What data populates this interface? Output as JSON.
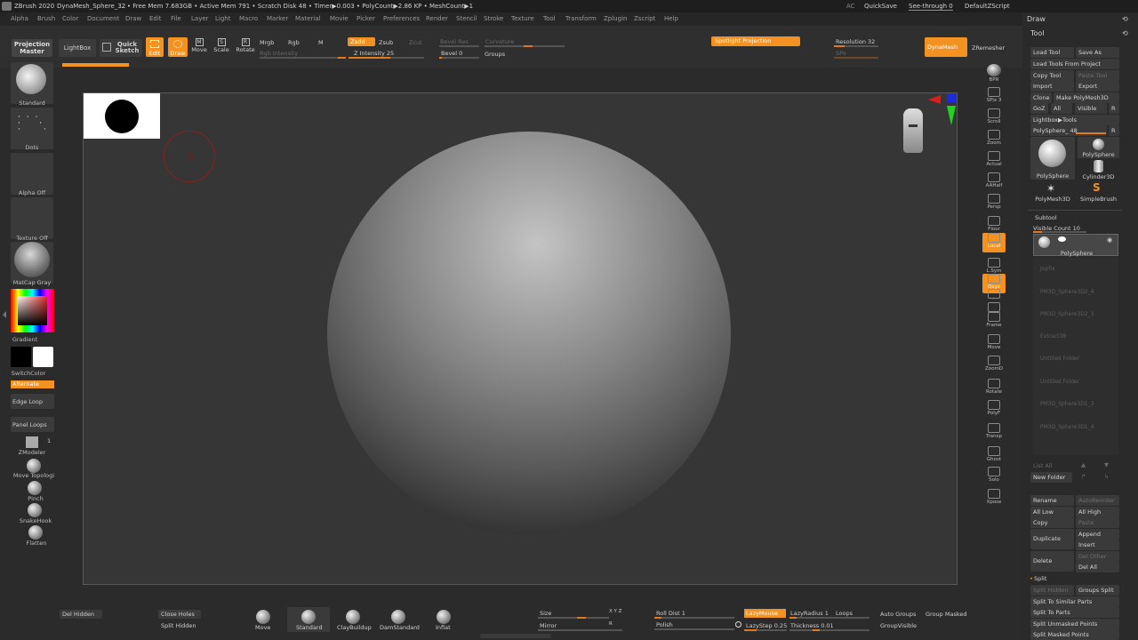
{
  "titlebar": {
    "app": "ZBrush 2020",
    "doc": "DynaMesh_Sphere_32",
    "stats": "... • Free Mem 7.683GB • Active Mem 791 • Scratch Disk 48 • Timer▶0.003 • PolyCount▶2.86 KP • MeshCount▶1",
    "ac": "AC",
    "quicksave": "QuickSave",
    "seethrough": "See-through  0",
    "script": "DefaultZScript"
  },
  "menu": [
    "Alpha",
    "Brush",
    "Color",
    "Document",
    "Draw",
    "Edit",
    "File",
    "Layer",
    "Light",
    "Macro",
    "Marker",
    "Material",
    "Movie",
    "Picker",
    "Preferences",
    "Render",
    "Stencil",
    "Stroke",
    "Texture",
    "Tool",
    "Transform",
    "Zplugin",
    "Zscript",
    "Help"
  ],
  "toolbar": {
    "projection_master": "Projection Master",
    "lightbox": "LightBox",
    "quick_sketch": "Quick Sketch",
    "edit": "Edit",
    "draw": "Draw",
    "move": "Move",
    "scale": "Scale",
    "rotate": "Rotate",
    "mrgb": "Mrgb",
    "rgb": "Rgb",
    "m": "M",
    "rgb_intensity": "Rgb Intensity",
    "zadd": "Zadd",
    "zsub": "Zsub",
    "zcut": "Zcut",
    "z_intensity": "Z Intensity 25",
    "bevel_res": "Bevel Res",
    "bevel": "Bevel 0",
    "curvature": "Curvature",
    "groups": "Groups",
    "spotlight": "Spotlight Projection",
    "resolution": "Resolution 32",
    "polish": "SPo",
    "dynamesh": "DynaMesh",
    "zremesher": "ZRemesher"
  },
  "left": {
    "standard": "Standard",
    "dots": "Dots",
    "alpha_off": "Alpha Off",
    "texture_off": "Texture Off",
    "matcap": "MatCap Gray",
    "gradient": "Gradient",
    "switchcolor": "SwitchColor",
    "alternate": "Alternate",
    "edge_loop": "Edge Loop",
    "panel_loops": "Panel Loops",
    "zmodeler": "ZModeler",
    "zmodeler_num": "1",
    "move_topo": "Move Topologi",
    "pinch": "Pinch",
    "snakehook": "SnakeHook",
    "flatten": "Flatten"
  },
  "rightshelf": [
    "BPR",
    "SPix 3",
    "Scroll",
    "Zoom",
    "Actual",
    "AAHalf",
    "Persp",
    "Floor",
    "Local",
    "L.Sym",
    "Qxyz",
    "",
    "",
    "Frame",
    "Move",
    "ZoomD",
    "Rotate",
    "PolyF",
    "Transp",
    "Ghost",
    "Solo",
    "Xpose"
  ],
  "panel": {
    "draw": "Draw",
    "tool": "Tool",
    "load_tool": "Load Tool",
    "save_as": "Save As",
    "load_from_project": "Load Tools From Project",
    "copy_tool": "Copy Tool",
    "paste_tool": "Paste Tool",
    "import": "Import",
    "export": "Export",
    "clone": "Clone",
    "make_polymesh": "Make PolyMesh3D",
    "goz": "GoZ",
    "all": "All",
    "visible": "Visible",
    "r": "R",
    "lightbox_tools": "Lightbox▶Tools",
    "polysphere_slider": "PolySphere_ 48",
    "tools": [
      "PolySphere",
      "PolySphere",
      "Cylinder3D",
      "PolyMesh3D",
      "SimpleBrush"
    ],
    "subtool": "Subtool",
    "visible_count": "Visible Count 10",
    "active_subtool": "PolySphere",
    "subtools": [
      "Jopfix",
      "PM3D_Sphere3D2_4",
      "PM3D_Sphere3D2_3",
      "Extract38",
      "Untitled Folder",
      "Untitled Folder",
      "PM3D_Sphere3D1_3",
      "PM3D_Sphere3D1_4"
    ],
    "list_all": "List All",
    "new_folder": "New Folder",
    "rename": "Rename",
    "autoreorder": "AutoReorder",
    "all_low": "All Low",
    "all_high": "All High",
    "copy": "Copy",
    "paste": "Paste",
    "duplicate": "Duplicate",
    "append": "Append",
    "insert": "Insert",
    "delete": "Delete",
    "del_other": "Del Other",
    "del_all": "Del All",
    "split": "Split",
    "split_hidden": "Split Hidden",
    "groups_split": "Groups Split",
    "split_similar": "Split To Similar Parts",
    "split_parts": "Split To Parts",
    "split_unmasked": "Split Unmasked Points",
    "split_masked": "Split Masked Points"
  },
  "bottom": {
    "del_hidden": "Del Hidden",
    "close_holes": "Close Holes",
    "split_hidden": "Split Hidden",
    "brushes": [
      "Move",
      "Standard",
      "ClayBuildup",
      "DamStandard",
      "Inflat"
    ],
    "size": "Size",
    "xyz": "X Y Z",
    "mirror": "Mirror",
    "mirror_r": "R",
    "roll_dist": "Roll Dist 1",
    "polish": "Polish",
    "lazymouse": "LazyMouse",
    "lazyradius": "LazyRadius 1",
    "loops": "Loops",
    "lazystep": "LazyStep 0.25",
    "thickness": "Thickness 0.01",
    "auto_groups": "Auto Groups",
    "group_masked": "Group Masked",
    "groupvisible": "GroupVisible"
  },
  "colors": {
    "accent": "#f39220",
    "background": "#2b2b2b",
    "canvas": "#363636"
  }
}
